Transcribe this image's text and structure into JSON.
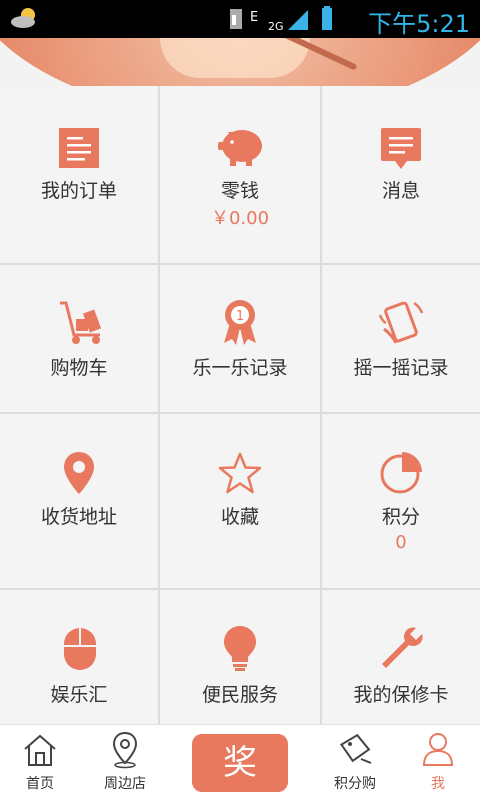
{
  "status_bar": {
    "time": "下午5:21",
    "network": "2G",
    "network_letter": "E"
  },
  "grid": [
    {
      "label": "我的订单",
      "icon": "order-icon"
    },
    {
      "label": "零钱",
      "sub": "￥0.00",
      "icon": "piggy-bank-icon"
    },
    {
      "label": "消息",
      "icon": "message-icon"
    },
    {
      "label": "购物车",
      "icon": "cart-icon"
    },
    {
      "label": "乐一乐记录",
      "icon": "badge-icon"
    },
    {
      "label": "摇一摇记录",
      "icon": "shake-phone-icon"
    },
    {
      "label": "收货地址",
      "icon": "location-pin-icon"
    },
    {
      "label": "收藏",
      "icon": "star-icon"
    },
    {
      "label": "积分",
      "sub": "0",
      "icon": "pie-chart-icon"
    },
    {
      "label": "娱乐汇",
      "icon": "mouse-icon"
    },
    {
      "label": "便民服务",
      "icon": "lightbulb-icon"
    },
    {
      "label": "我的保修卡",
      "icon": "wrench-icon"
    }
  ],
  "bottom_nav": {
    "home": "首页",
    "nearby": "周边店",
    "center": "奖",
    "points_shop": "积分购",
    "me": "我"
  },
  "colors": {
    "accent": "#e8795e",
    "grid_bg": "#f4f4f4",
    "divider": "#dcdcdc"
  }
}
